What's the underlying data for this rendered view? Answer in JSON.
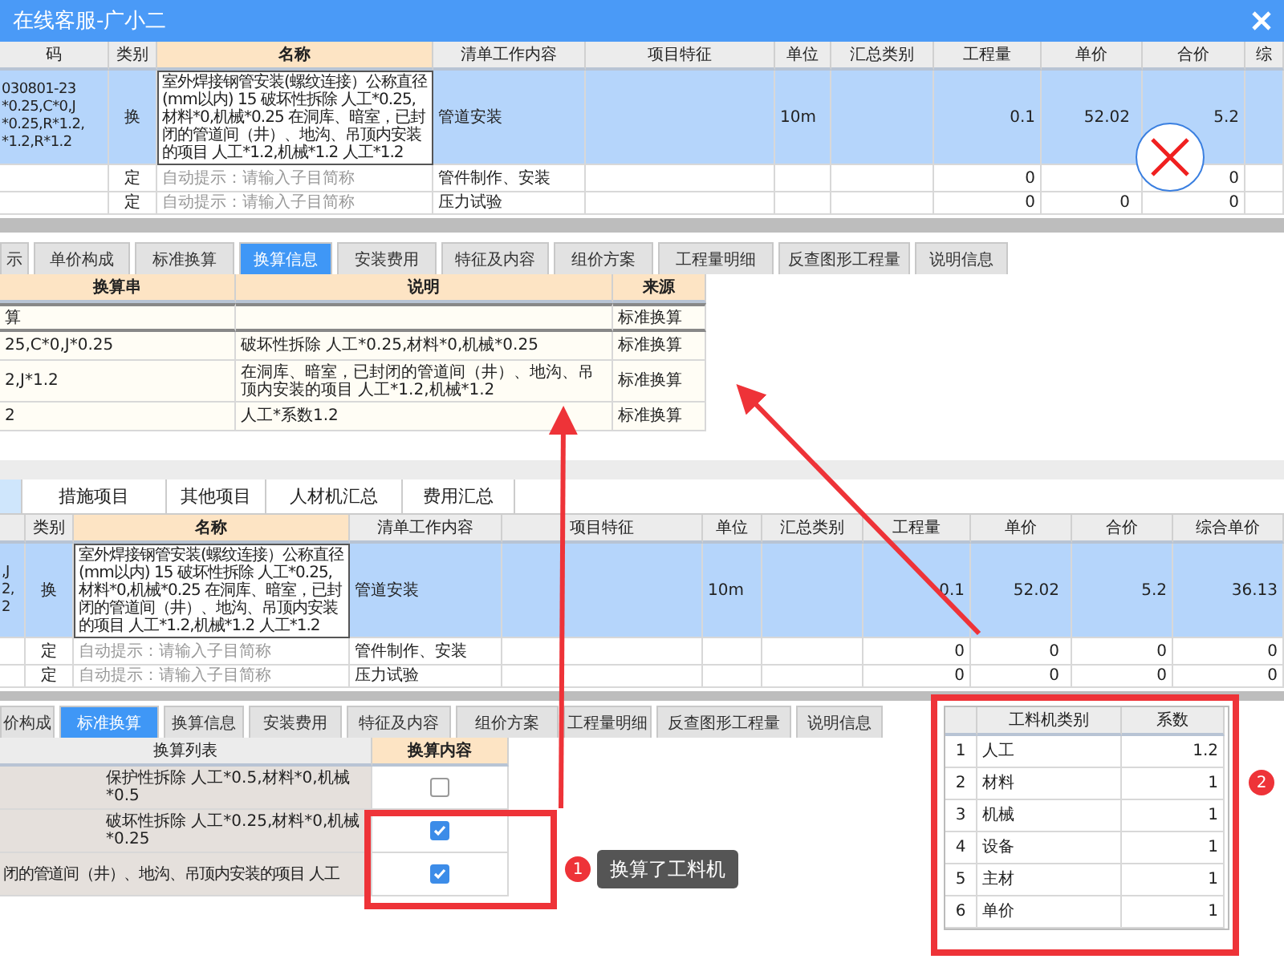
{
  "window": {
    "title": "在线客服-广小二"
  },
  "top_table": {
    "columns": [
      {
        "label": "码",
        "active": false
      },
      {
        "label": "类别",
        "active": false
      },
      {
        "label": "名称",
        "active": true
      },
      {
        "label": "清单工作内容",
        "active": false
      },
      {
        "label": "项目特征",
        "active": false
      },
      {
        "label": "单位",
        "active": false
      },
      {
        "label": "汇总类别",
        "active": false
      },
      {
        "label": "工程量",
        "active": false
      },
      {
        "label": "单价",
        "active": false
      },
      {
        "label": "合价",
        "active": false
      },
      {
        "label": "综",
        "active": false
      }
    ],
    "rows": [
      {
        "selected": true,
        "name_is_hint": false,
        "code": "030801-23\n*0.25,C*0,J\n*0.25,R*1.2,\n*1.2,R*1.2",
        "type": "换",
        "name": "室外焊接钢管安装(螺纹连接）公称直径(mm以内) 15  破坏性拆除 人工*0.25,材料*0,机械*0.25  在洞库、暗室，已封闭的管道间（井）、地沟、吊顶内安装的项目 人工*1.2,机械*1.2  人工*1.2",
        "content": "管道安装",
        "unit": "10m",
        "qty": "0.1",
        "price": "52.02",
        "total": "5.2"
      },
      {
        "selected": false,
        "name_is_hint": true,
        "type": "定",
        "name": "自动提示：请输入子目简称",
        "content": "管件制作、安装",
        "qty": "0",
        "total": "0"
      },
      {
        "selected": false,
        "name_is_hint": true,
        "type": "定",
        "name": "自动提示：请输入子目简称",
        "content": "压力试验",
        "qty": "0",
        "price": "0",
        "total": "0"
      }
    ]
  },
  "tabs_1": [
    {
      "label": "示",
      "selected": false
    },
    {
      "label": "单价构成",
      "selected": false
    },
    {
      "label": "标准换算",
      "selected": false
    },
    {
      "label": "换算信息",
      "selected": true
    },
    {
      "label": "安装费用",
      "selected": false
    },
    {
      "label": "特征及内容",
      "selected": false
    },
    {
      "label": "组价方案",
      "selected": false
    },
    {
      "label": "工程量明细",
      "selected": false
    },
    {
      "label": "反查图形工程量",
      "selected": false
    },
    {
      "label": "说明信息",
      "selected": false
    }
  ],
  "info_table": {
    "columns": [
      "换算串",
      "说明",
      "来源"
    ],
    "rows": [
      {
        "selected": true,
        "expr": "算",
        "source": "标准换算"
      },
      {
        "selected": false,
        "expr": "25,C*0,J*0.25",
        "note": "破坏性拆除 人工*0.25,材料*0,机械*0.25",
        "source": "标准换算"
      },
      {
        "selected": false,
        "expr": "2,J*1.2",
        "note": "在洞库、暗室，已封闭的管道间（井）、地沟、吊顶内安装的项目 人工*1.2,机械*1.2",
        "source": "标准换算"
      },
      {
        "selected": false,
        "expr": "2",
        "note": "人工*系数1.2",
        "source": "标准换算"
      }
    ]
  },
  "tabs_2": [
    {
      "selected": true
    },
    {
      "label": "措施项目",
      "selected": false
    },
    {
      "label": "其他项目",
      "selected": false
    },
    {
      "label": "人材机汇总",
      "selected": false
    },
    {
      "label": "费用汇总",
      "selected": false
    }
  ],
  "lower_table": {
    "columns": [
      {
        "label": "类别",
        "active": false
      },
      {
        "label": "名称",
        "active": true
      },
      {
        "label": "清单工作内容",
        "active": false
      },
      {
        "label": "项目特征",
        "active": false
      },
      {
        "label": "单位",
        "active": false
      },
      {
        "label": "汇总类别",
        "active": false
      },
      {
        "label": "工程量",
        "active": false
      },
      {
        "label": "单价",
        "active": false
      },
      {
        "label": "合价",
        "active": false
      },
      {
        "label": "综合单价",
        "active": false
      }
    ],
    "rows": [
      {
        "selected": true,
        "name_is_hint": false,
        "code": ",J\n2,\n2",
        "type": "换",
        "name": "室外焊接钢管安装(螺纹连接）公称直径(mm以内) 15  破坏性拆除 人工*0.25,材料*0,机械*0.25  在洞库、暗室，已封闭的管道间（井）、地沟、吊顶内安装的项目 人工*1.2,机械*1.2  人工*1.2",
        "content": "管道安装",
        "unit": "10m",
        "qty": "0.1",
        "price": "52.02",
        "total": "5.2",
        "comp": "36.13"
      },
      {
        "selected": false,
        "name_is_hint": true,
        "type": "定",
        "name": "自动提示：请输入子目简称",
        "content": "管件制作、安装",
        "qty": "0",
        "price": "0",
        "total": "0",
        "comp": "0"
      },
      {
        "selected": false,
        "name_is_hint": true,
        "type": "定",
        "name": "自动提示：请输入子目简称",
        "content": "压力试验",
        "qty": "0",
        "price": "0",
        "total": "0",
        "comp": "0"
      }
    ]
  },
  "tabs_3": [
    {
      "label": "价构成",
      "selected": false
    },
    {
      "label": "标准换算",
      "selected": true
    },
    {
      "label": "换算信息",
      "selected": false
    },
    {
      "label": "安装费用",
      "selected": false
    },
    {
      "label": "特征及内容",
      "selected": false
    },
    {
      "label": "组价方案",
      "selected": false
    },
    {
      "label": "工程量明细",
      "selected": false
    },
    {
      "label": "反查图形工程量",
      "selected": false
    },
    {
      "label": "说明信息",
      "selected": false
    }
  ],
  "conversion_list": {
    "columns": [
      "换算列表",
      "换算内容"
    ],
    "rows": [
      {
        "kind": "item",
        "text": "保护性拆除 人工*0.5,材料*0,机械*0.5",
        "checked": false
      },
      {
        "kind": "item",
        "text": "破坏性拆除 人工*0.25,材料*0,机械*0.25",
        "checked": true
      },
      {
        "kind": "group",
        "text": "闭的管道间（井）、地沟、吊顶内安装的项目 人工",
        "checked": true
      }
    ]
  },
  "callout_1": {
    "number": "1",
    "text": "换算了工料机"
  },
  "coef_table": {
    "columns": [
      "工料机类别",
      "系数"
    ],
    "rows": [
      {
        "no": "1",
        "name": "人工",
        "coef": "1.2"
      },
      {
        "no": "2",
        "name": "材料",
        "coef": "1"
      },
      {
        "no": "3",
        "name": "机械",
        "coef": "1"
      },
      {
        "no": "4",
        "name": "设备",
        "coef": "1"
      },
      {
        "no": "5",
        "name": "主材",
        "coef": "1"
      },
      {
        "no": "6",
        "name": "单价",
        "coef": "1"
      }
    ]
  },
  "callout_2": {
    "number": "2"
  }
}
